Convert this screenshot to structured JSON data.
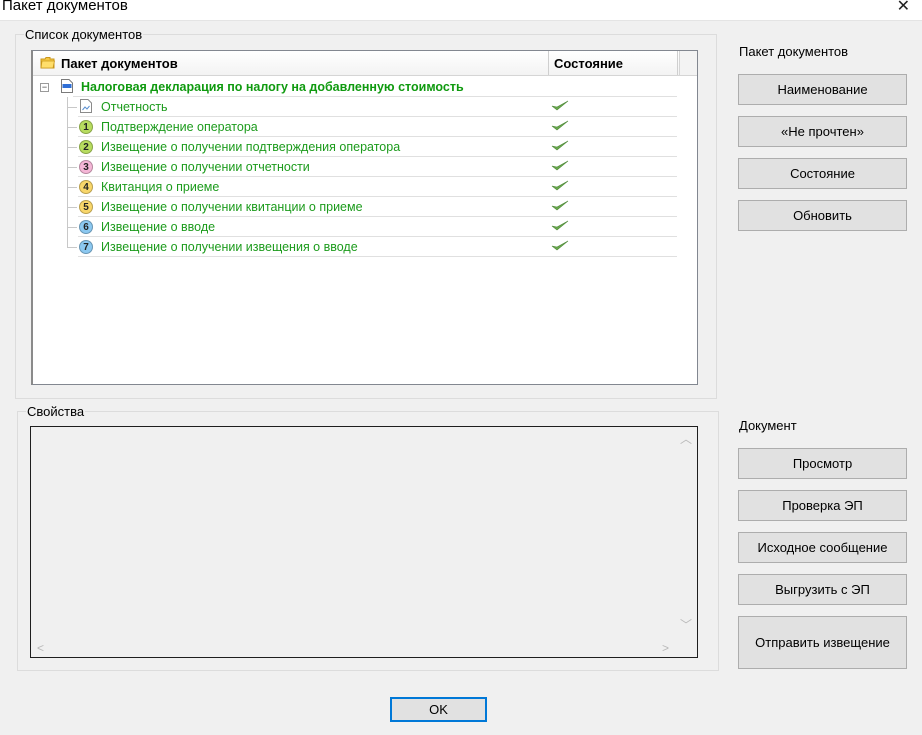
{
  "window": {
    "title": "Пакет документов",
    "close_glyph": "✕"
  },
  "list_group": {
    "legend": "Список документов",
    "header": {
      "name_col": "Пакет документов",
      "status_col": "Состояние"
    },
    "root": {
      "label": "Налоговая декларация по налогу на добавленную стоимость",
      "expander": "−"
    },
    "items": [
      {
        "label": "Отчетность",
        "badge": "",
        "badge_color": "",
        "status_icon": "check-icon"
      },
      {
        "label": "Подтверждение оператора",
        "badge": "1",
        "badge_color": "#b7dc5f",
        "status_icon": "check-icon"
      },
      {
        "label": "Извещение о получении подтверждения оператора",
        "badge": "2",
        "badge_color": "#b7dc5f",
        "status_icon": "check-icon"
      },
      {
        "label": "Извещение о получении отчетности",
        "badge": "3",
        "badge_color": "#f4b6d6",
        "status_icon": "check-icon"
      },
      {
        "label": "Квитанция о приеме",
        "badge": "4",
        "badge_color": "#f8d66a",
        "status_icon": "check-icon"
      },
      {
        "label": "Извещение о получении квитанции о приеме",
        "badge": "5",
        "badge_color": "#f8d66a",
        "status_icon": "check-icon"
      },
      {
        "label": "Извещение о вводе",
        "badge": "6",
        "badge_color": "#8cc8f0",
        "status_icon": "check-icon"
      },
      {
        "label": "Извещение о получении извещения о вводе",
        "badge": "7",
        "badge_color": "#8cc8f0",
        "status_icon": "check-icon"
      }
    ]
  },
  "props_group": {
    "legend": "Свойства"
  },
  "package_panel": {
    "label": "Пакет документов",
    "buttons": [
      "Наименование",
      "«Не прочтен»",
      "Состояние",
      "Обновить"
    ]
  },
  "document_panel": {
    "label": "Документ",
    "buttons": [
      "Просмотр",
      "Проверка ЭП",
      "Исходное сообщение",
      "Выгрузить с ЭП",
      "Отправить извещение"
    ]
  },
  "ok_button": "OK",
  "colors": {
    "item_text": "#1c9b1c",
    "accent": "#0078d7",
    "check": "#6aa84f"
  }
}
